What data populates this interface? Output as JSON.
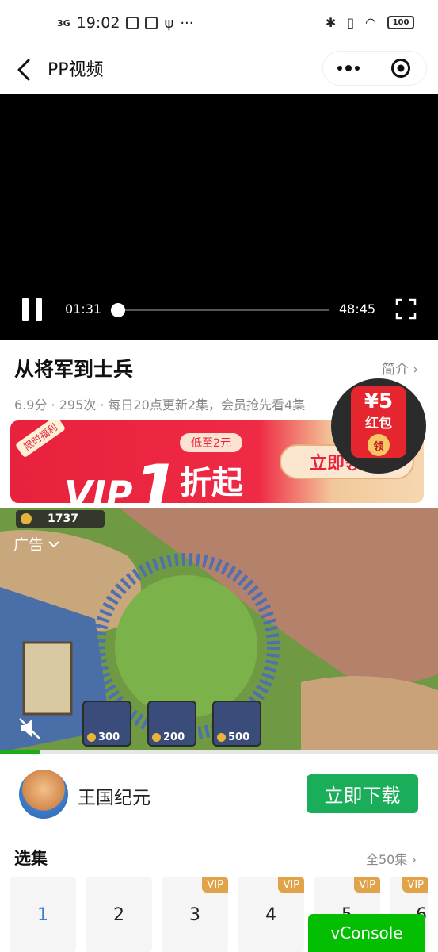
{
  "status_bar": {
    "signal": "3G",
    "time": "19:02",
    "more": "···",
    "battery": "100"
  },
  "nav": {
    "title": "PP视频"
  },
  "player": {
    "current_time": "01:31",
    "duration": "48:45",
    "progress_fraction": 0.031
  },
  "show": {
    "title": "从将军到士兵",
    "intro_link": "简介 ›",
    "meta": "6.9分 · 295次 · 每日20点更新2集，会员抢先看4集"
  },
  "vip_banner": {
    "corner": "限时福利",
    "vip": "VIP",
    "one": "1",
    "low": "低至2元",
    "zhe": "折起",
    "claim": "立即领取"
  },
  "red_packet": {
    "amount": "¥5",
    "label": "红包",
    "coin": "领"
  },
  "ad": {
    "coins": "1737",
    "label": "广告",
    "units": [
      "300",
      "200",
      "500"
    ]
  },
  "app": {
    "name": "王国纪元",
    "download": "立即下载"
  },
  "episodes": {
    "title": "选集",
    "all": "全50集 ›",
    "items": [
      {
        "num": "1",
        "vip": ""
      },
      {
        "num": "2",
        "vip": ""
      },
      {
        "num": "3",
        "vip": "VIP"
      },
      {
        "num": "4",
        "vip": "VIP"
      },
      {
        "num": "5",
        "vip": "VIP"
      },
      {
        "num": "6",
        "vip": "VIP"
      }
    ]
  },
  "vconsole": "vConsole",
  "colors": {
    "accent_green": "#1aad5a",
    "vip_red": "#e8213d",
    "episode_active": "#3b7bd4",
    "vip_tag": "#e0a34a"
  }
}
